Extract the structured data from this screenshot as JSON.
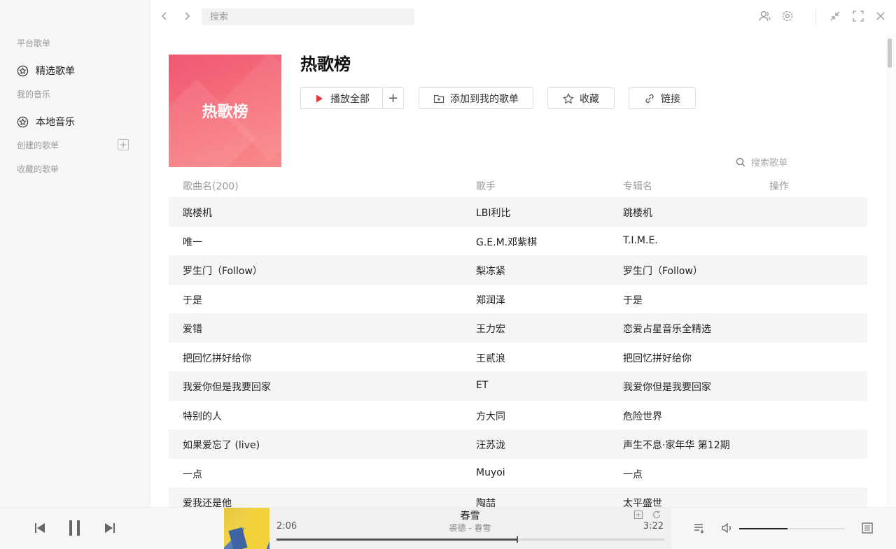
{
  "sidebar": {
    "section_platform": "平台歌单",
    "item_featured": "精选歌单",
    "section_my_music": "我的音乐",
    "item_local": "本地音乐",
    "section_created": "创建的歌单",
    "section_collected": "收藏的歌单"
  },
  "topbar": {
    "search_placeholder": "搜索"
  },
  "playlist": {
    "cover_text": "热歌榜",
    "title": "热歌榜",
    "play_all": "播放全部",
    "add_to_mine": "添加到我的歌单",
    "favorite": "收藏",
    "link": "链接",
    "search_songs_placeholder": "搜索歌单"
  },
  "table": {
    "headers": {
      "name": "歌曲名(200)",
      "artist": "歌手",
      "album": "专辑名",
      "ops": "操作"
    },
    "rows": [
      {
        "name": "跳楼机",
        "artist": "LBI利比",
        "album": "跳楼机"
      },
      {
        "name": "唯一",
        "artist": "G.E.M.邓紫棋",
        "album": "T.I.M.E."
      },
      {
        "name": "罗生门（Follow）",
        "artist": "梨冻紧",
        "album": "罗生门（Follow）"
      },
      {
        "name": "于是",
        "artist": "郑润泽",
        "album": "于是"
      },
      {
        "name": "爱错",
        "artist": "王力宏",
        "album": "恋爱占星音乐全精选"
      },
      {
        "name": "把回忆拼好给你",
        "artist": "王贰浪",
        "album": "把回忆拼好给你"
      },
      {
        "name": "我爱你但是我要回家",
        "artist": "ET",
        "album": "我爱你但是我要回家"
      },
      {
        "name": "特别的人",
        "artist": "方大同",
        "album": "危险世界"
      },
      {
        "name": "如果爱忘了 (live)",
        "artist": "汪苏泷",
        "album": "声生不息·家年华 第12期"
      },
      {
        "name": "一点",
        "artist": "Muyoi",
        "album": "一点"
      },
      {
        "name": "爱我还是他",
        "artist": "陶喆",
        "album": "太平盛世"
      }
    ]
  },
  "player": {
    "current_time": "2:06",
    "total_time": "3:22",
    "title": "春雪",
    "artist": "裘德 - 春雪",
    "progress": 0.62,
    "volume": 0.46
  }
}
